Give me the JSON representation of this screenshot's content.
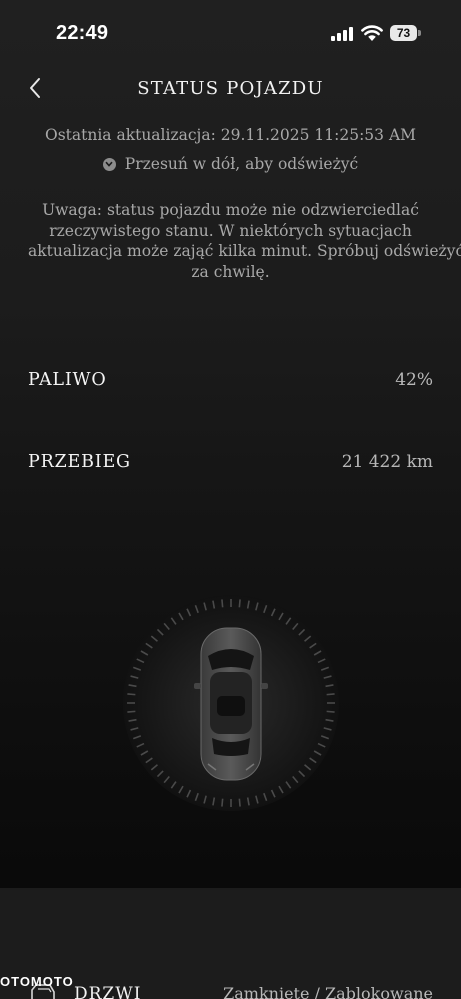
{
  "status_bar": {
    "time": "22:49",
    "battery": "73",
    "icons": [
      "signal-icon",
      "wifi-icon",
      "battery-icon"
    ]
  },
  "header": {
    "back_icon": "chevron-left-icon",
    "title": "STATUS POJAZDU"
  },
  "update": {
    "last_update": "Ostatnia aktualizacja:  29.11.2025 11:25:53 AM",
    "refresh_hint": "Przesuń w dół, aby odświeżyć",
    "refresh_icon": "chevron-down-icon"
  },
  "notice": {
    "lines": [
      "Uwaga: status pojazdu może nie odzwierciedlać",
      "rzeczywistego stanu. W niektórych sytuacjach",
      "aktualizacja może zająć kilka minut. Spróbuj odświeżyć",
      "za chwilę."
    ]
  },
  "stats": {
    "fuel": {
      "label": "PALIWO",
      "value": "42%"
    },
    "mileage": {
      "label": "PRZEBIEG",
      "value": "21 422 km"
    }
  },
  "vehicle": {
    "icon": "car-top-view-icon"
  },
  "doors": {
    "icon": "door-icon",
    "label": "DRZWI",
    "value": "Zamknięte / Zablokowane"
  },
  "watermark": "OTOMOTO",
  "colors": {
    "background": "#1c1c1c",
    "text_primary": "#f2f2f2",
    "text_secondary": "#a8a8a8",
    "battery_bg": "#e9e9e9"
  }
}
